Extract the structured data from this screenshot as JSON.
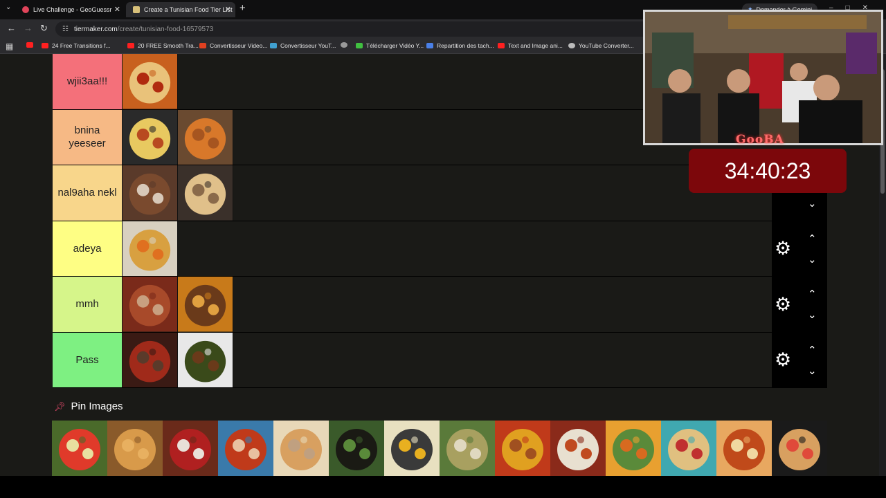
{
  "browser": {
    "tabs": [
      {
        "title": "Live Challenge - GeoGuessr",
        "favicon_color": "#e0445a"
      },
      {
        "title": "Create a Tunisian Food Tier List",
        "favicon_color": "#d8c07a"
      }
    ],
    "gemini_label": "Demander à Gemini",
    "url_host": "tiermaker.com",
    "url_path": "/create/tunisian-food-16579573",
    "bookmarks": [
      {
        "label": "24 Free Transitions f...",
        "color": "#ff2020"
      },
      {
        "label": "20 FREE Smooth Tra...",
        "color": "#ff2020"
      },
      {
        "label": "Convertisseur Video...",
        "color": "#e04020"
      },
      {
        "label": "Convertisseur YouT...",
        "color": "#40a0d0"
      },
      {
        "label": "Télécharger Vidéo Y...",
        "color": "#40c040"
      },
      {
        "label": "Repartition des tach...",
        "color": "#4a80e8"
      },
      {
        "label": "Text and Image ani...",
        "color": "#ff2020"
      },
      {
        "label": "YouTube Converter...",
        "color": "#bbbbbb"
      }
    ]
  },
  "tiers": [
    {
      "label": "wjii3aa!!!",
      "color": "#f4707a",
      "items": [
        "pizza"
      ]
    },
    {
      "label": "bnina yeeseer",
      "color": "#f6b985",
      "items": [
        "pasta-skillet",
        "chorba-soup"
      ]
    },
    {
      "label": "nal9aha nekl",
      "color": "#f8d68b",
      "items": [
        "grilled-meat",
        "mlawi-bread"
      ]
    },
    {
      "label": "adeya",
      "color": "#fefe84",
      "items": [
        "couscous"
      ]
    },
    {
      "label": "mmh",
      "color": "#d6f58a",
      "items": [
        "meat-stew",
        "roast-lamb"
      ]
    },
    {
      "label": "Pass",
      "color": "#7ef082",
      "items": [
        "tomato-stew",
        "spinach-dish"
      ]
    }
  ],
  "pin_images": {
    "title": "Pin Images",
    "items": [
      "salad-platter",
      "grilled-sandwich",
      "red-bowl",
      "spaghetti",
      "brik",
      "mloukhia",
      "egg-salad",
      "green-dish",
      "peppers",
      "ojja",
      "couscous-veg",
      "wraps",
      "lasagna",
      "baguette-sandwich"
    ]
  },
  "overlay": {
    "caption": "GooBA",
    "timer": "34:40:23"
  }
}
